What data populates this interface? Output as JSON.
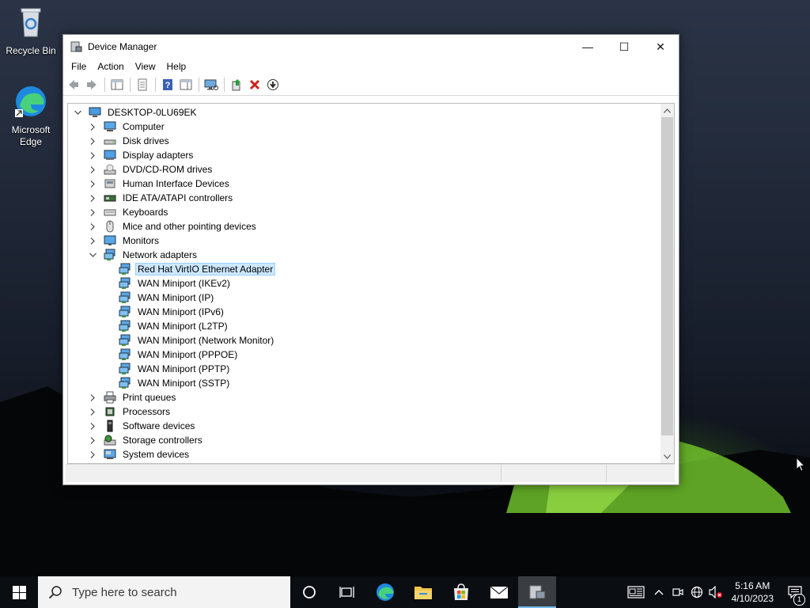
{
  "desktop": {
    "icons": [
      {
        "label": "Recycle Bin"
      },
      {
        "label": "Microsoft Edge"
      }
    ]
  },
  "window": {
    "title": "Device Manager",
    "controls": {
      "minimize": "—",
      "maximize": "☐",
      "close": "✕"
    },
    "menu": [
      "File",
      "Action",
      "View",
      "Help"
    ],
    "toolbar_icons": [
      "back-arrow-icon",
      "forward-arrow-icon",
      "show-hide-console-tree-icon",
      "properties-icon",
      "help-icon",
      "action-pane-icon",
      "scan-hardware-icon",
      "update-driver-icon",
      "uninstall-device-icon",
      "disable-device-icon"
    ],
    "tree": {
      "root": "DESKTOP-0LU69EK",
      "categories": [
        {
          "label": "Computer",
          "icon": "computer-icon"
        },
        {
          "label": "Disk drives",
          "icon": "disk-drive-icon"
        },
        {
          "label": "Display adapters",
          "icon": "display-adapter-icon"
        },
        {
          "label": "DVD/CD-ROM drives",
          "icon": "dvd-drive-icon"
        },
        {
          "label": "Human Interface Devices",
          "icon": "hid-icon"
        },
        {
          "label": "IDE ATA/ATAPI controllers",
          "icon": "ide-controller-icon"
        },
        {
          "label": "Keyboards",
          "icon": "keyboard-icon"
        },
        {
          "label": "Mice and other pointing devices",
          "icon": "mouse-icon"
        },
        {
          "label": "Monitors",
          "icon": "monitor-icon"
        },
        {
          "label": "Network adapters",
          "icon": "network-adapter-icon",
          "expanded": true,
          "children": [
            "Red Hat VirtIO Ethernet Adapter",
            "WAN Miniport (IKEv2)",
            "WAN Miniport (IP)",
            "WAN Miniport (IPv6)",
            "WAN Miniport (L2TP)",
            "WAN Miniport (Network Monitor)",
            "WAN Miniport (PPPOE)",
            "WAN Miniport (PPTP)",
            "WAN Miniport (SSTP)"
          ]
        },
        {
          "label": "Print queues",
          "icon": "printer-icon"
        },
        {
          "label": "Processors",
          "icon": "processor-icon"
        },
        {
          "label": "Software devices",
          "icon": "software-device-icon"
        },
        {
          "label": "Storage controllers",
          "icon": "storage-controller-icon"
        },
        {
          "label": "System devices",
          "icon": "system-device-icon"
        }
      ],
      "selected": "Red Hat VirtIO Ethernet Adapter"
    }
  },
  "taskbar": {
    "search_placeholder": "Type here to search",
    "clock_time": "5:16 AM",
    "clock_date": "4/10/2023",
    "notification_count": "1"
  }
}
